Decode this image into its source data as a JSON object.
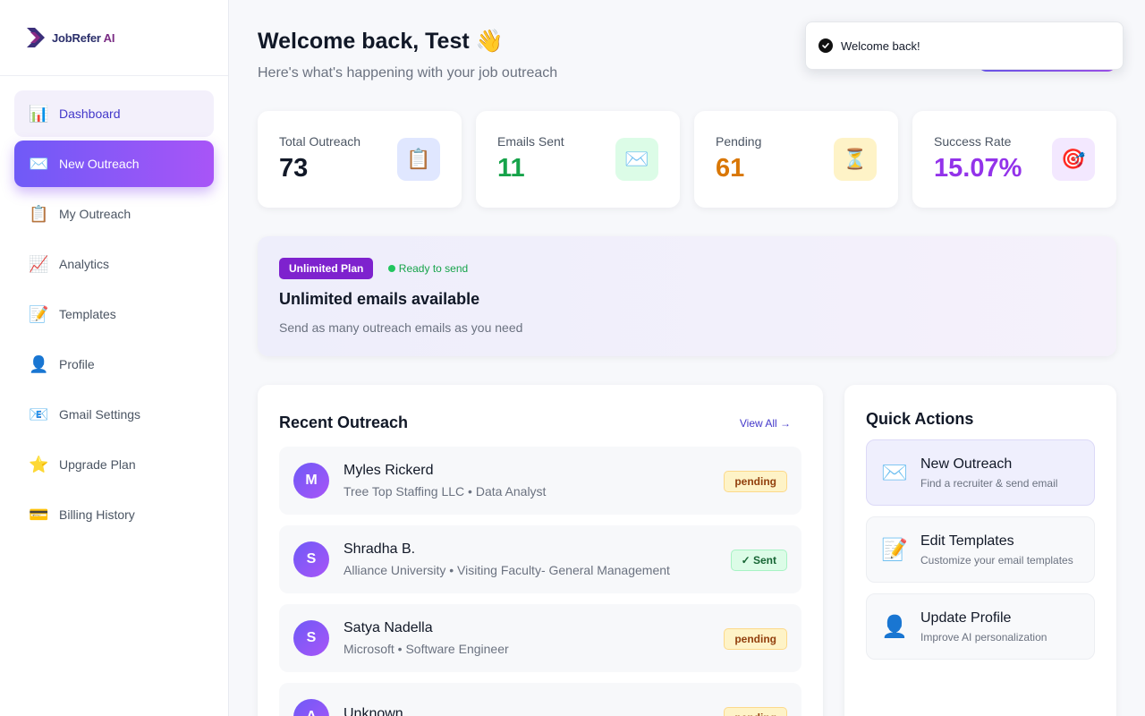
{
  "brand": {
    "name_part1": "JobRefer",
    "name_part2": " AI"
  },
  "sidebar": {
    "items": [
      {
        "label": "Dashboard",
        "icon": "📊"
      },
      {
        "label": "New Outreach",
        "icon": "✉️"
      },
      {
        "label": "My Outreach",
        "icon": "📋"
      },
      {
        "label": "Analytics",
        "icon": "📈"
      },
      {
        "label": "Templates",
        "icon": "📝"
      },
      {
        "label": "Profile",
        "icon": "👤"
      },
      {
        "label": "Gmail Settings",
        "icon": "📧"
      },
      {
        "label": "Upgrade Plan",
        "icon": "⭐"
      },
      {
        "label": "Billing History",
        "icon": "💳"
      }
    ]
  },
  "header": {
    "title": "Welcome back, Test 👋",
    "subtitle": "Here's what's happening with your job outreach"
  },
  "stats": [
    {
      "label": "Total Outreach",
      "value": "73",
      "icon": "📋",
      "color": "#111827",
      "icon_bg": "#e0e7ff"
    },
    {
      "label": "Emails Sent",
      "value": "11",
      "icon": "✉️",
      "color": "#16a34a",
      "icon_bg": "#dcfce7"
    },
    {
      "label": "Pending",
      "value": "61",
      "icon": "⏳",
      "color": "#d97706",
      "icon_bg": "#fef3c7"
    },
    {
      "label": "Success Rate",
      "value": "15.07%",
      "icon": "🎯",
      "color": "#9333ea",
      "icon_bg": "#f3e8ff"
    }
  ],
  "plan": {
    "badge": "Unlimited Plan",
    "status": "Ready to send",
    "title": "Unlimited emails available",
    "description": "Send as many outreach emails as you need"
  },
  "recent": {
    "title": "Recent Outreach",
    "view_all": "View All →",
    "rows": [
      {
        "initial": "M",
        "name": "Myles Rickerd",
        "detail": "Tree Top Staffing LLC • Data Analyst",
        "status": "pending",
        "status_type": "pending"
      },
      {
        "initial": "S",
        "name": "Shradha B.",
        "detail": "Alliance University • Visiting Faculty- General Management",
        "status": "✓ Sent",
        "status_type": "sent"
      },
      {
        "initial": "S",
        "name": "Satya Nadella",
        "detail": "Microsoft • Software Engineer",
        "status": "pending",
        "status_type": "pending"
      },
      {
        "initial": "A",
        "name": "Unknown",
        "detail": "",
        "status": "pending",
        "status_type": "pending"
      }
    ]
  },
  "quick_actions": {
    "title": "Quick Actions",
    "items": [
      {
        "icon": "✉️",
        "title": "New Outreach",
        "subtitle": "Find a recruiter & send email"
      },
      {
        "icon": "📝",
        "title": "Edit Templates",
        "subtitle": "Customize your email templates"
      },
      {
        "icon": "👤",
        "title": "Update Profile",
        "subtitle": "Improve AI personalization"
      }
    ]
  },
  "toast": {
    "message": "Welcome back!"
  }
}
